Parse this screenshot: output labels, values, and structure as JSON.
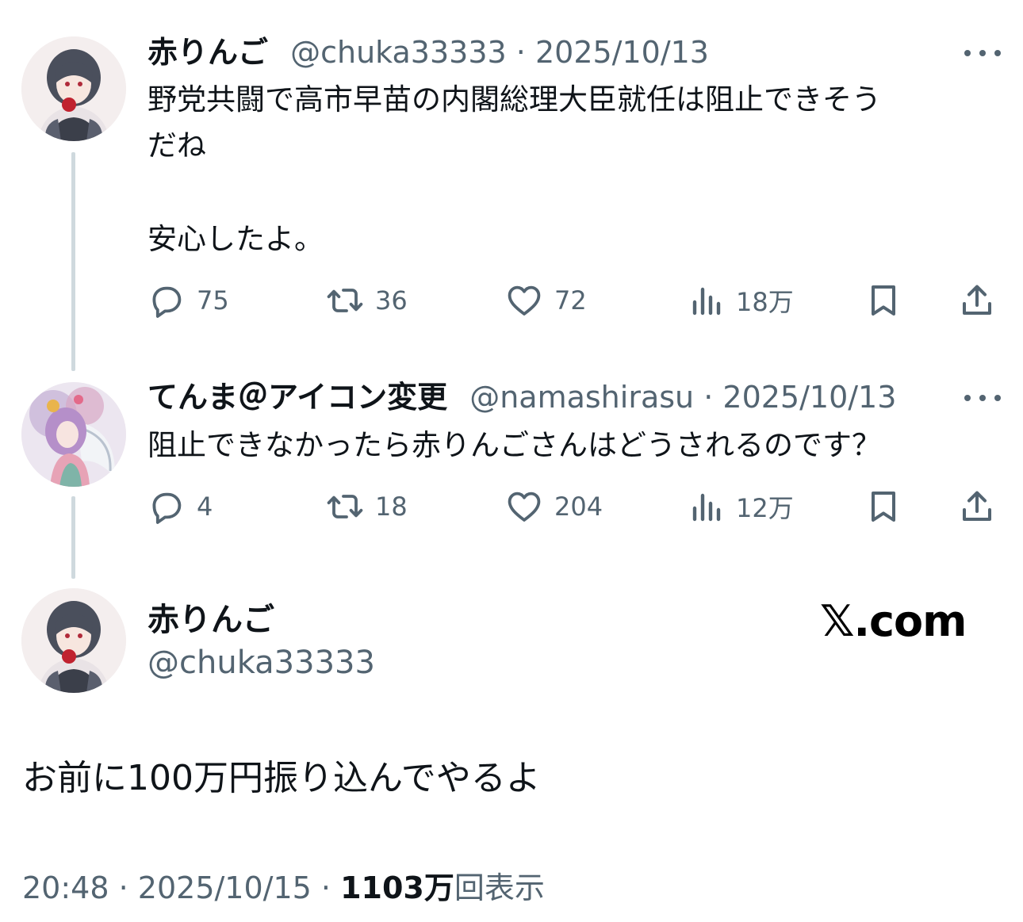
{
  "colors": {
    "text_primary": "#0f1419",
    "text_secondary": "#536471",
    "thread_line": "#cfd9de",
    "background": "#ffffff"
  },
  "reply1": {
    "display_name": "赤りんご",
    "handle": "@chuka33333",
    "separator": "·",
    "date": "2025/10/13",
    "text_line1": "野党共闘で高市早苗の内閣総理大臣就任は阻止できそう",
    "text_line2": "だね",
    "text_line3": "安心したよ。",
    "actions": {
      "replies": "75",
      "retweets": "36",
      "likes": "72",
      "views": "18万"
    }
  },
  "reply2": {
    "display_name": "てんま＠アイコン変更",
    "handle": "@namashirasu",
    "separator": "·",
    "date": "2025/10/13",
    "text": "阻止できなかったら赤りんごさんはどうされるのです？",
    "actions": {
      "replies": "4",
      "retweets": "18",
      "likes": "204",
      "views": "12万"
    }
  },
  "main_post": {
    "display_name": "赤りんご",
    "handle": "@chuka33333",
    "text": "お前に100万円振り込んでやるよ",
    "time": "20:48",
    "separator": "·",
    "date": "2025/10/15",
    "views_count": "1103万",
    "views_label": "回表示"
  },
  "watermark": {
    "text": "𝕏.com"
  },
  "icons": [
    "reply-icon",
    "retweet-icon",
    "like-icon",
    "views-icon",
    "bookmark-icon",
    "share-icon",
    "more-icon"
  ]
}
